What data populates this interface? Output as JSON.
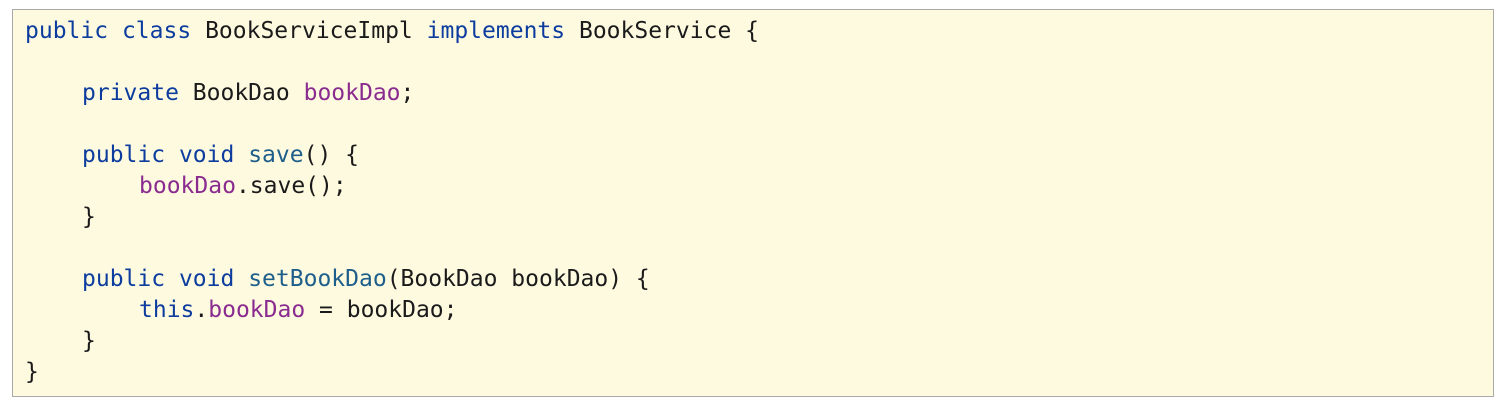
{
  "colors": {
    "background": "#fefae0",
    "border": "#a9a9a9",
    "keyword": "#0c3d9e",
    "field": "#8a2c8f",
    "method": "#1d5f8a",
    "text": "#1a1a1a"
  },
  "code": {
    "line1": {
      "kw_public": "public",
      "kw_class": "class",
      "class_name": "BookServiceImpl",
      "kw_implements": "implements",
      "interface_name": "BookService",
      "brace": "{"
    },
    "line3": {
      "kw_private": "private",
      "type": "BookDao",
      "field": "bookDao",
      "semicolon": ";"
    },
    "line5": {
      "kw_public": "public",
      "kw_void": "void",
      "method": "save",
      "signature_rest": "() {"
    },
    "line6": {
      "field": "bookDao",
      "call": ".save();"
    },
    "line7": {
      "brace": "}"
    },
    "line9": {
      "kw_public": "public",
      "kw_void": "void",
      "method": "setBookDao",
      "params": "(BookDao bookDao) {"
    },
    "line10": {
      "kw_this": "this",
      "dot": ".",
      "field": "bookDao",
      "assign": " = bookDao;"
    },
    "line11": {
      "brace": "}"
    },
    "line12": {
      "brace": "}"
    }
  }
}
